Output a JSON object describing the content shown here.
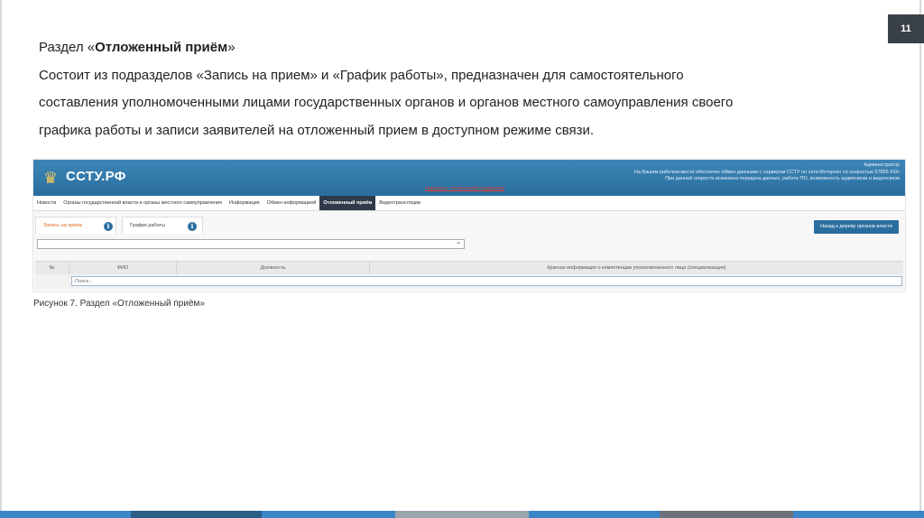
{
  "slide": {
    "page_number": "11",
    "heading_prefix": "Раздел «",
    "heading_bold": "Отложенный приём",
    "heading_suffix": "»",
    "line1": "Состоит из подразделов «Запись на прием» и «График работы», предназначен для самостоятельного",
    "line2": "составления уполномоченными лицами государственных органов и органов местного самоуправления своего",
    "line3": "графика работы и записи заявителей на отложенный прием в доступном режиме связи.",
    "caption": "Рисунок 7. Раздел «Отложенный приём»"
  },
  "app": {
    "logo": "ССТУ.РФ",
    "header_info": {
      "role": "Администратор",
      "line1": "На Вашем рабочем месте обеспечен обмен данными с сервером ССТУ по сети Интернет со скоростью 57865 Кб/с",
      "line2": "При данной скорости возможна передача данных, работа ПО, возможность аудиосвязи и видеосвязи"
    },
    "alert_link": "Нарушить технический поддержки",
    "nav": [
      "Новости",
      "Органы государственной власти и органы местного самоуправления",
      "Информация",
      "Обмен информацией",
      "Отложенный приём",
      "Видеотрансляции"
    ],
    "active_nav": "Отложенный приём",
    "tabs": {
      "booking": "Запись на приём",
      "schedule": "График работы"
    },
    "back_button": "Назад к дереву органов власти",
    "table_headers": {
      "num": "№",
      "fio": "ФИО",
      "position": "Должность",
      "info": "Краткая информация о компетенции уполномоченного лица (специализация)"
    },
    "search_placeholder": "Поиск..."
  },
  "colors": {
    "header_blue": "#2a6e9f",
    "active_nav": "#2f3a4a",
    "selected_tab": "#e06b1f",
    "alert_red": "#e53b2f"
  },
  "icons": {
    "info": "info-circle-icon",
    "emblem": "coat-of-arms-icon",
    "dropdown": "chevron-down-icon"
  }
}
